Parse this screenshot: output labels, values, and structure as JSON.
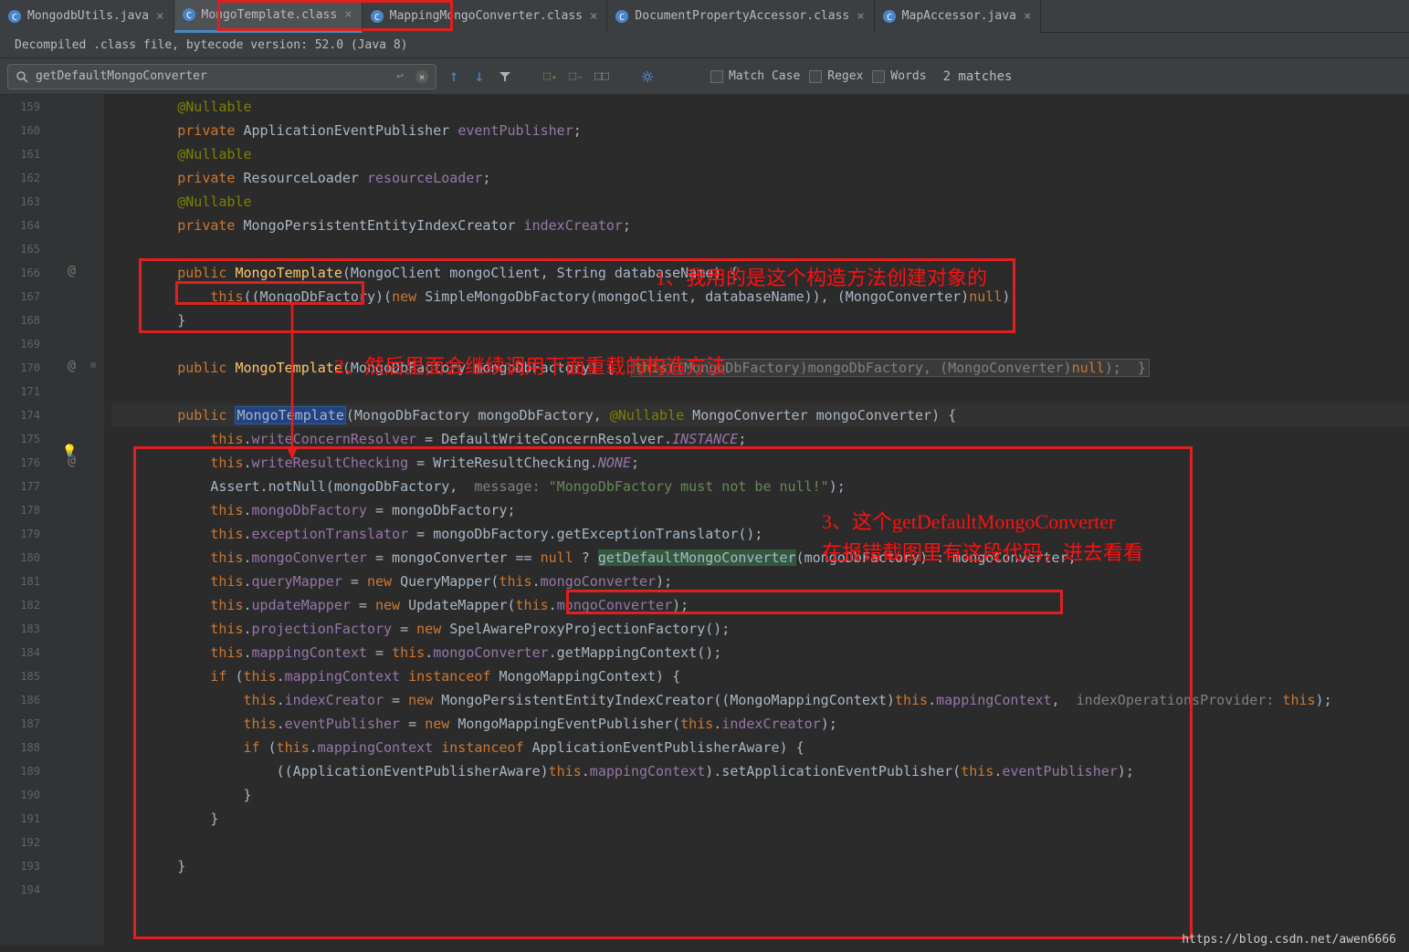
{
  "tabs": [
    {
      "label": "MongodbUtils.java",
      "type": "java"
    },
    {
      "label": "MongoTemplate.class",
      "type": "class",
      "active": true
    },
    {
      "label": "MappingMongoConverter.class",
      "type": "class"
    },
    {
      "label": "DocumentPropertyAccessor.class",
      "type": "class"
    },
    {
      "label": "MapAccessor.java",
      "type": "java"
    }
  ],
  "infoBar": "Decompiled .class file, bytecode version: 52.0 (Java 8)",
  "search": {
    "value": "getDefaultMongoConverter",
    "matchCase": "Match Case",
    "regex": "Regex",
    "words": "Words",
    "matches": "2 matches"
  },
  "lineStart": 159,
  "lineEnd": 194,
  "annotations": {
    "a1": "1、我用的是这个构造方法创建对象的",
    "a2": "2、然后里面会继续调用下面重载的构造方法",
    "a3_l1": "3、这个getDefaultMongoConverter",
    "a3_l2": "在报错截图里有这段代码，进去看看"
  },
  "code": {
    "l159": "@Nullable",
    "l160_kw": "private ",
    "l160_type": "ApplicationEventPublisher ",
    "l160_var": "eventPublisher",
    "l160_end": ";",
    "l161": "@Nullable",
    "l162_kw": "private ",
    "l162_type": "ResourceLoader ",
    "l162_var": "resourceLoader",
    "l162_end": ";",
    "l163": "@Nullable",
    "l164_kw": "private ",
    "l164_type": "MongoPersistentEntityIndexCreator ",
    "l164_var": "indexCreator",
    "l164_end": ";",
    "l166_kw": "public ",
    "l166_name": "MongoTemplate",
    "l166_params": "(MongoClient mongoClient, String databaseName) {",
    "l167_this": "this",
    "l167_a": "((MongoDbFactory)(",
    "l167_new": "new ",
    "l167_b": "SimpleMongoDbFactory(mongoClient, databaseName)), (MongoConverter)",
    "l167_null": "null",
    "l167_c": ");",
    "l168": "}",
    "l170_kw": "public ",
    "l170_name": "MongoTemplate",
    "l170_a": "(MongoDbFactory mongoDbFactory) {  ",
    "l170_this": "this",
    "l170_b": "((MongoDbFactory)mongoDbFactory, (MongoConverter)",
    "l170_null": "null",
    "l170_c": ");  }",
    "l174_kw": "public ",
    "l174_name": "MongoTemplate",
    "l174_a": "(MongoDbFactory mongoDbFactory, ",
    "l174_ann": "@Nullable ",
    "l174_b": "MongoConverter mongoConverter) {",
    "l175_this": "this",
    "l175_a": ".",
    "l175_f": "writeConcernResolver",
    "l175_b": " = DefaultWriteConcernResolver.",
    "l175_c": "INSTANCE",
    "l175_d": ";",
    "l176_this": "this",
    "l176_a": ".",
    "l176_f": "writeResultChecking",
    "l176_b": " = WriteResultChecking.",
    "l176_c": "NONE",
    "l176_d": ";",
    "l177_a": "Assert.notNull(mongoDbFactory,  ",
    "l177_hint": "message: ",
    "l177_str": "\"MongoDbFactory must not be null!\"",
    "l177_b": ");",
    "l178_this": "this",
    "l178_a": ".",
    "l178_f": "mongoDbFactory",
    "l178_b": " = mongoDbFactory;",
    "l179_this": "this",
    "l179_a": ".",
    "l179_f": "exceptionTranslator",
    "l179_b": " = mongoDbFactory.getExceptionTranslator();",
    "l180_this": "this",
    "l180_a": ".",
    "l180_f": "mongoConverter",
    "l180_b": " = mongoConverter == ",
    "l180_null": "null",
    "l180_c": " ? ",
    "l180_call": "getDefaultMongoConverter",
    "l180_d": "(mongoDbFactory) : mongoConverter;",
    "l181_this": "this",
    "l181_a": ".",
    "l181_f": "queryMapper",
    "l181_b": " = ",
    "l181_new": "new ",
    "l181_c": "QueryMapper(",
    "l181_this2": "this",
    "l181_d": ".",
    "l181_f2": "mongoConverter",
    "l181_e": ");",
    "l182_this": "this",
    "l182_a": ".",
    "l182_f": "updateMapper",
    "l182_b": " = ",
    "l182_new": "new ",
    "l182_c": "UpdateMapper(",
    "l182_this2": "this",
    "l182_d": ".",
    "l182_f2": "mongoConverter",
    "l182_e": ");",
    "l183_this": "this",
    "l183_a": ".",
    "l183_f": "projectionFactory",
    "l183_b": " = ",
    "l183_new": "new ",
    "l183_c": "SpelAwareProxyProjectionFactory();",
    "l184_this": "this",
    "l184_a": ".",
    "l184_f": "mappingContext",
    "l184_b": " = ",
    "l184_this2": "this",
    "l184_c": ".",
    "l184_f2": "mongoConverter",
    "l184_d": ".getMappingContext();",
    "l185_if": "if ",
    "l185_a": "(",
    "l185_this": "this",
    "l185_b": ".",
    "l185_f": "mappingContext",
    "l185_c": " ",
    "l185_inst": "instanceof ",
    "l185_d": "MongoMappingContext) {",
    "l186_this": "this",
    "l186_a": ".",
    "l186_f": "indexCreator",
    "l186_b": " = ",
    "l186_new": "new ",
    "l186_c": "MongoPersistentEntityIndexCreator((MongoMappingContext)",
    "l186_this2": "this",
    "l186_d": ".",
    "l186_f2": "mappingContext",
    "l186_e": ",  ",
    "l186_hint": "indexOperationsProvider: ",
    "l186_this3": "this",
    "l186_g": ");",
    "l187_this": "this",
    "l187_a": ".",
    "l187_f": "eventPublisher",
    "l187_b": " = ",
    "l187_new": "new ",
    "l187_c": "MongoMappingEventPublisher(",
    "l187_this2": "this",
    "l187_d": ".",
    "l187_f2": "indexCreator",
    "l187_e": ");",
    "l188_if": "if ",
    "l188_a": "(",
    "l188_this": "this",
    "l188_b": ".",
    "l188_f": "mappingContext",
    "l188_c": " ",
    "l188_inst": "instanceof ",
    "l188_d": "ApplicationEventPublisherAware) {",
    "l189_a": "((ApplicationEventPublisherAware)",
    "l189_this": "this",
    "l189_b": ".",
    "l189_f": "mappingContext",
    "l189_c": ").setApplicationEventPublisher(",
    "l189_this2": "this",
    "l189_d": ".",
    "l189_f2": "eventPublisher",
    "l189_e": ");",
    "l190": "}",
    "l191": "}",
    "l193": "}"
  },
  "watermark": "https://blog.csdn.net/awen6666"
}
